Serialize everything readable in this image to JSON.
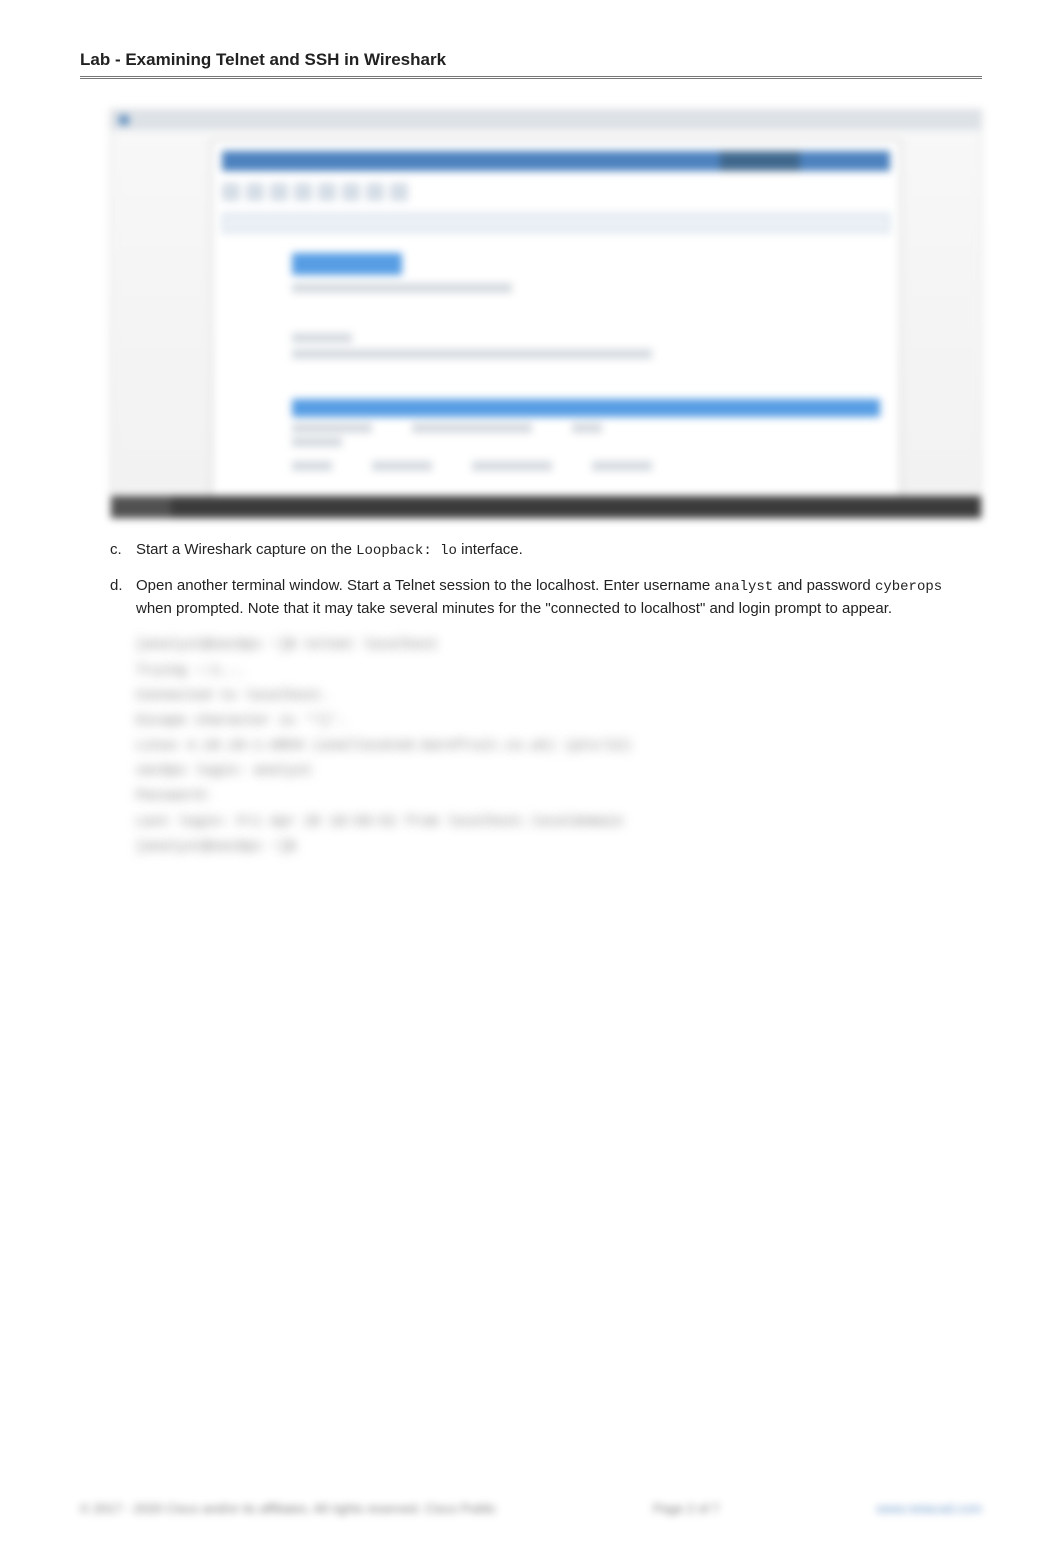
{
  "header": {
    "title": "Lab - Examining Telnet and SSH in Wireshark"
  },
  "steps": {
    "c": {
      "marker": "c.",
      "text_before": "Start a Wireshark capture on the ",
      "code": "Loopback: lo",
      "text_after": " interface."
    },
    "d": {
      "marker": "d.",
      "text_1": "Open another terminal window. Start a Telnet session to the localhost. Enter username ",
      "code_1": "analyst",
      "text_2": " and password ",
      "code_2": "cyberops",
      "text_3": " when prompted. Note that it may take several minutes for the \"connected to localhost\" and login prompt to appear."
    }
  },
  "terminal": {
    "lines": [
      "[analyst@secOps ~]$ telnet localhost",
      "Trying ::1...",
      "Connected to localhost.",
      "Escape character is '^]'.",
      "",
      "Linux 4.10.10-1-ARCH (unallocated.barefruit.co.uk) (pts/12)",
      "",
      "secOps login: analyst",
      "Password:",
      "Last login: Fri Apr 28 10:50:52 from localhost.localdomain",
      "[analyst@secOps ~]$"
    ]
  },
  "footer": {
    "copyright": "© 2017 - 2020 Cisco and/or its affiliates. All rights reserved. Cisco Public",
    "page": "Page 2 of 7",
    "link": "www.netacad.com"
  }
}
